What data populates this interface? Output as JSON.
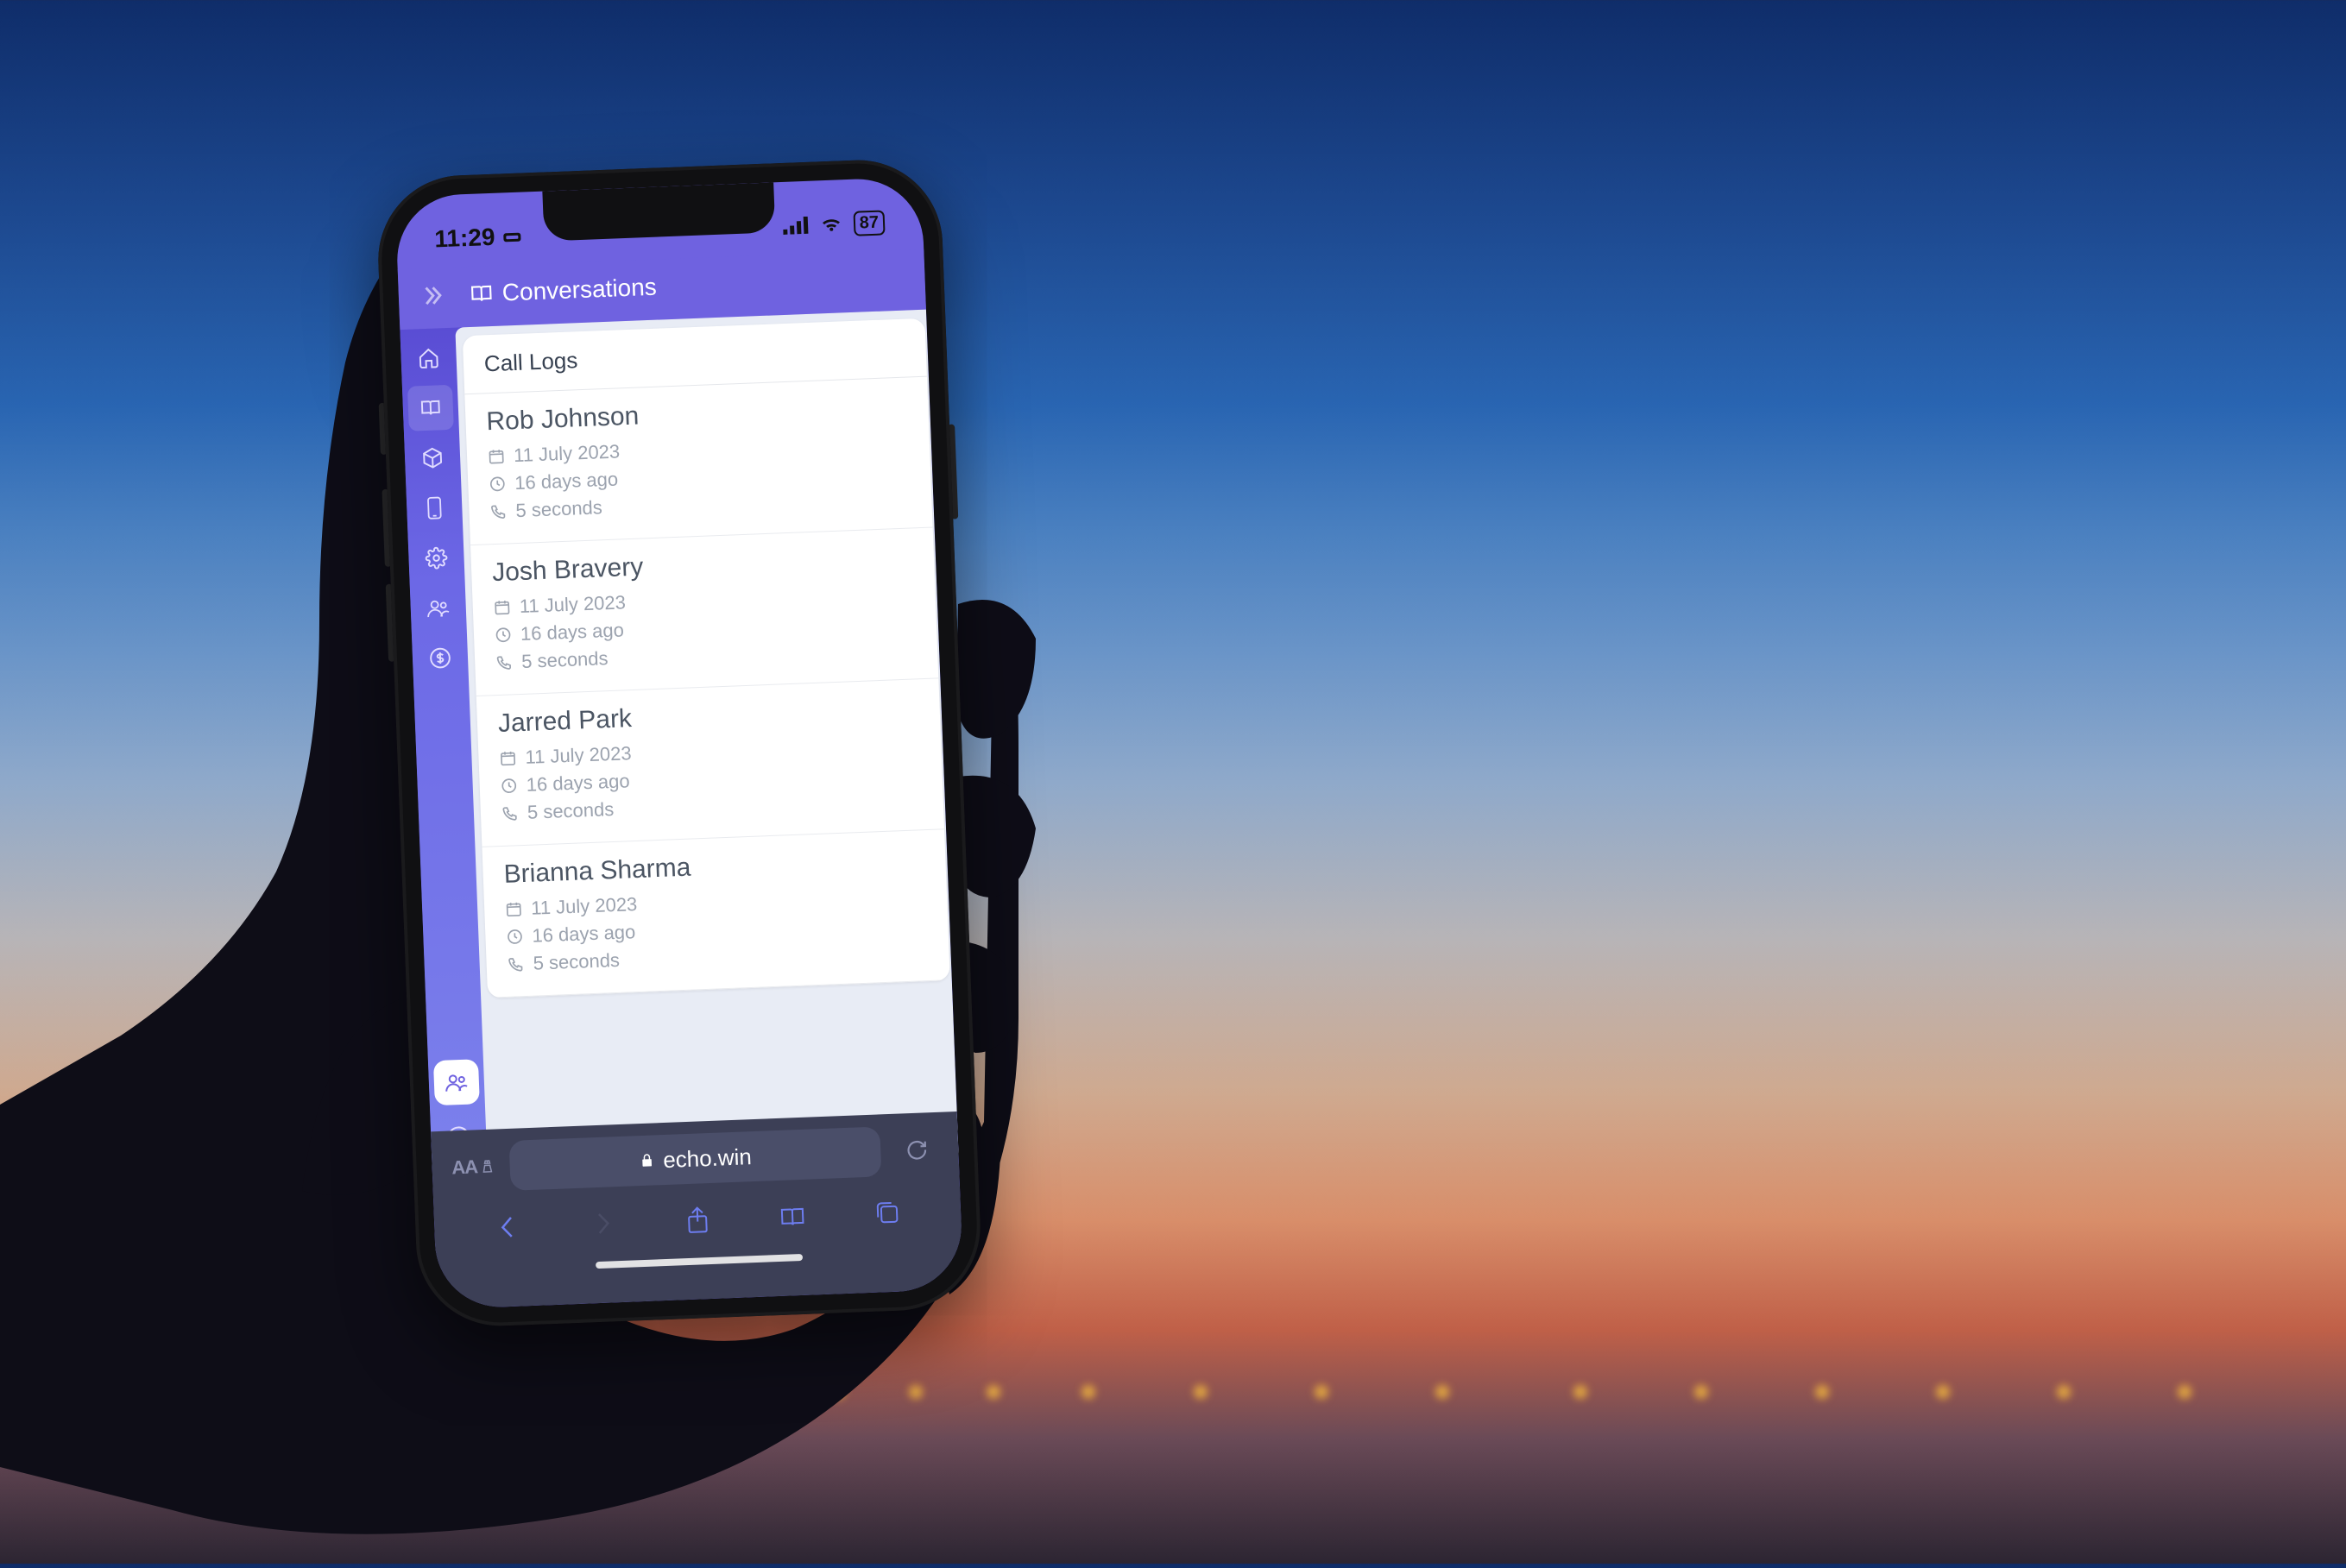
{
  "statusbar": {
    "time": "11:29",
    "battery": "87"
  },
  "header": {
    "title": "Conversations"
  },
  "panel": {
    "title": "Call Logs"
  },
  "logs": [
    {
      "name": "Rob Johnson",
      "date": "11 July 2023",
      "ago": "16 days ago",
      "duration": "5 seconds"
    },
    {
      "name": "Josh Bravery",
      "date": "11 July 2023",
      "ago": "16 days ago",
      "duration": "5 seconds"
    },
    {
      "name": "Jarred Park",
      "date": "11 July 2023",
      "ago": "16 days ago",
      "duration": "5 seconds"
    },
    {
      "name": "Brianna Sharma",
      "date": "11 July 2023",
      "ago": "16 days ago",
      "duration": "5 seconds"
    }
  ],
  "browser": {
    "aa_label": "AA",
    "url": "echo.win"
  },
  "sidebar": {
    "items": [
      {
        "id": "home"
      },
      {
        "id": "conversations"
      },
      {
        "id": "package"
      },
      {
        "id": "phone"
      },
      {
        "id": "settings"
      },
      {
        "id": "contacts"
      },
      {
        "id": "billing"
      }
    ]
  }
}
